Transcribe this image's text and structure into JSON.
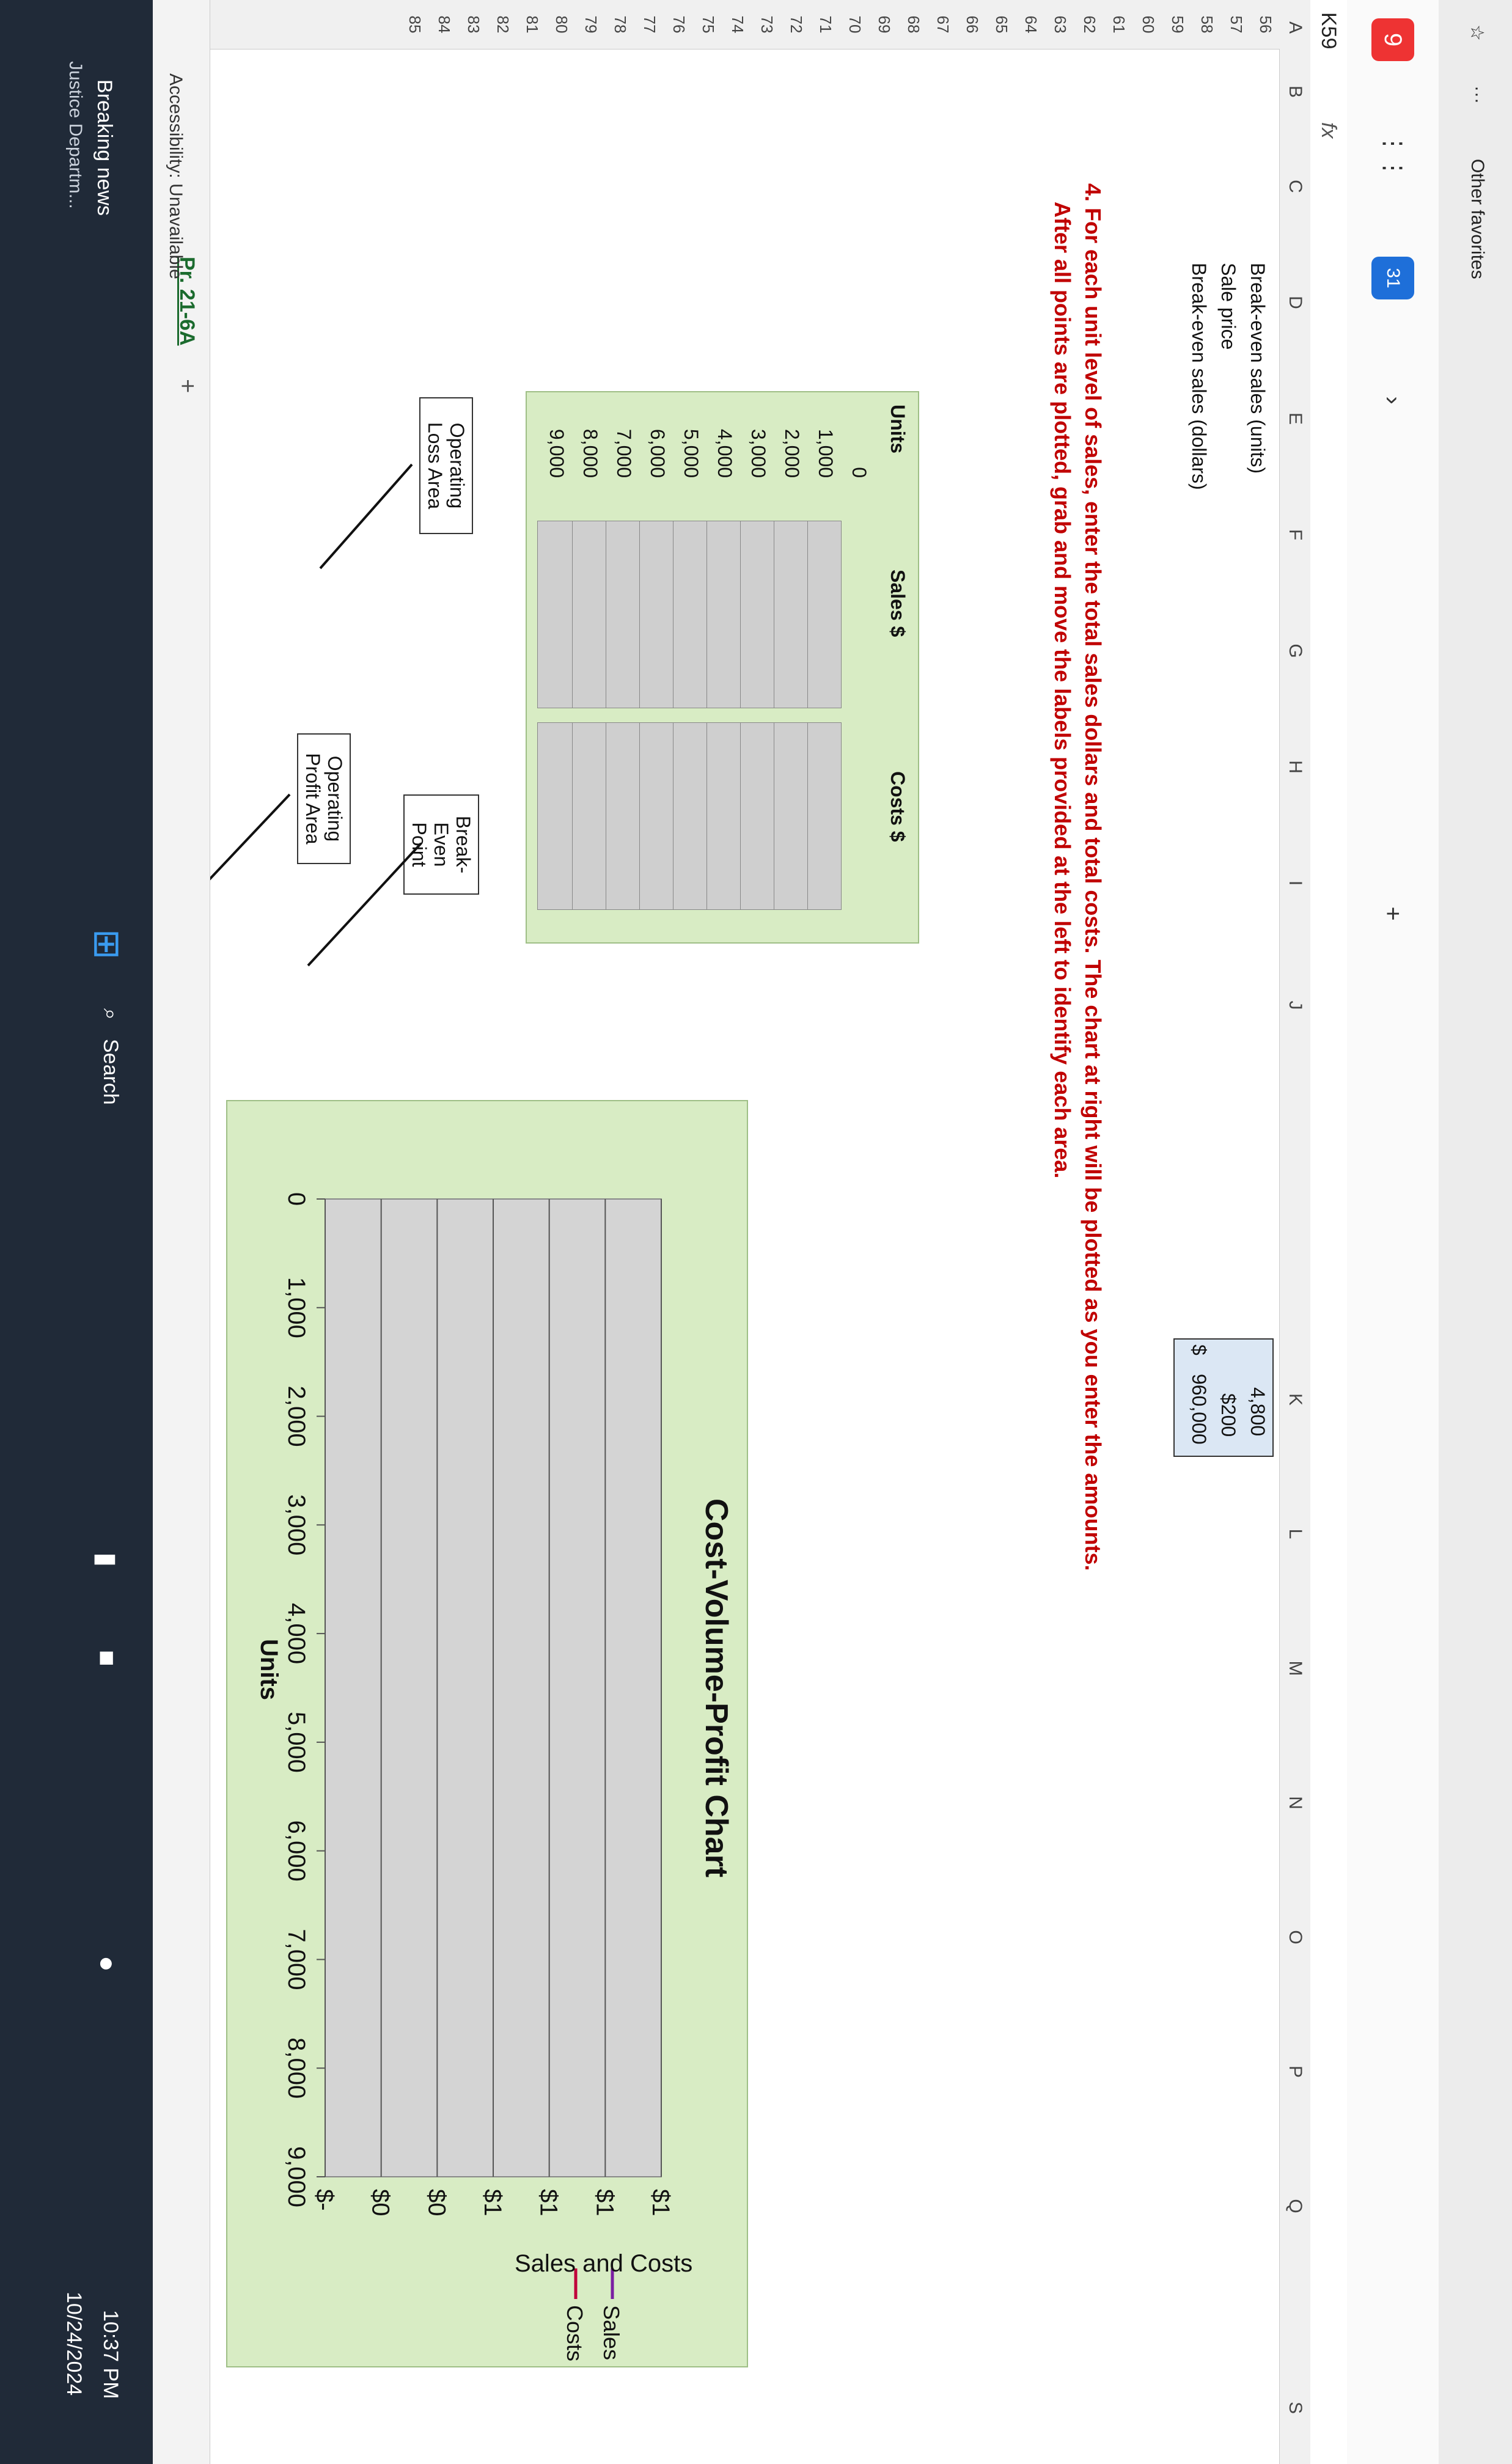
{
  "favorites": {
    "other_favorites": "Other favorites"
  },
  "excel": {
    "name_box": "K59",
    "fx": "fx",
    "columns": [
      "A",
      "B",
      "C",
      "D",
      "E",
      "F",
      "G",
      "H",
      "I",
      "J",
      "K",
      "L",
      "M",
      "N",
      "O",
      "P",
      "Q",
      "S"
    ],
    "rows": [
      "56",
      "57",
      "58",
      "59",
      "60",
      "61",
      "62",
      "63",
      "64",
      "65",
      "66",
      "67",
      "68",
      "69",
      "70",
      "71",
      "72",
      "73",
      "74",
      "75",
      "76",
      "77",
      "78",
      "79",
      "80",
      "81",
      "82",
      "83",
      "84",
      "85"
    ],
    "breakeven": {
      "units_label": "Break-even sales (units)",
      "units_value": "4,800",
      "price_label": "Sale price",
      "price_value": "$200",
      "dollars_label": "Break-even sales (dollars)",
      "dollars_symbol": "$",
      "dollars_value": "960,000"
    },
    "instruction_1": "4.  For each unit level of sales, enter the total sales dollars and total costs. The chart at right will be plotted as you enter the amounts.",
    "instruction_2": "After all points are plotted, grab and move the labels provided at the left to identify each area.",
    "table": {
      "col_units": "Units",
      "col_sales": "Sales $",
      "col_costs": "Costs $",
      "units": [
        "0",
        "1,000",
        "2,000",
        "3,000",
        "4,000",
        "5,000",
        "6,000",
        "7,000",
        "8,000",
        "9,000"
      ]
    },
    "labels": {
      "operating_loss": "Operating Loss Area",
      "break_even": "Break-Even Point",
      "operating_profit": "Operating Profit Area"
    },
    "sheet_tab": "Pr. 21-6A",
    "accessibility": "Accessibility: Unavailable"
  },
  "chart_data": {
    "type": "line",
    "title": "Cost-Volume-Profit Chart",
    "xlabel": "Units",
    "ylabel": "Sales and Costs",
    "x": [
      "0",
      "1,000",
      "2,000",
      "3,000",
      "4,000",
      "5,000",
      "6,000",
      "7,000",
      "8,000",
      "9,000"
    ],
    "y_ticks": [
      "$-",
      "$0",
      "$0",
      "$1",
      "$1",
      "$1",
      "$1"
    ],
    "series": [
      {
        "name": "Sales $",
        "values": []
      },
      {
        "name": "Costs $",
        "values": []
      }
    ],
    "grid": true,
    "legend": "right"
  },
  "taskbar": {
    "time": "10:37 PM",
    "date": "10/24/2024",
    "news_title": "Breaking news",
    "news_sub": "Justice Departm...",
    "search": "Search"
  }
}
